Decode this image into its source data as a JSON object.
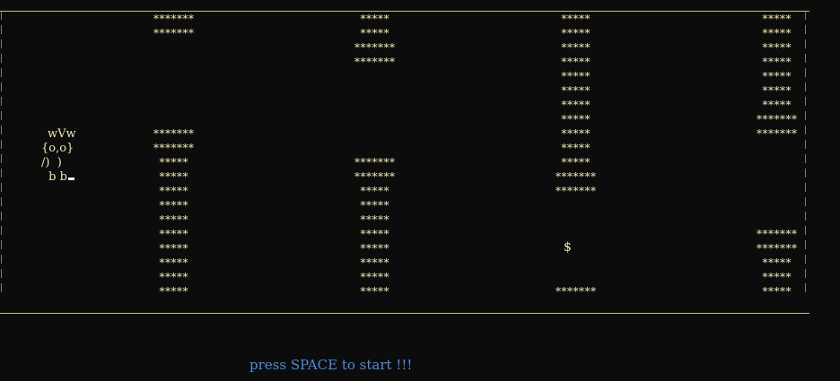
{
  "game": {
    "start_prompt": "press SPACE to start !!!",
    "player": {
      "line1": "wVw",
      "line2": "{o,o}",
      "line3": "/)  )",
      "line4": " b b"
    },
    "coin": "$",
    "wall_wide": "*******",
    "wall_narrow": "*****"
  },
  "colors": {
    "background": "#0c0c0c",
    "walls": "#f2e9b6",
    "border": "#cdbd85",
    "prompt": "#4c8cdc",
    "cursor": "#ffffff"
  },
  "walls": [
    {
      "column": 1,
      "rows": [
        {
          "row": 0,
          "text": "*******"
        },
        {
          "row": 1,
          "text": "*******"
        },
        {
          "row": 8,
          "text": "*******"
        },
        {
          "row": 9,
          "text": "*******"
        },
        {
          "row": 10,
          "text": "*****"
        },
        {
          "row": 11,
          "text": "*****"
        },
        {
          "row": 12,
          "text": "*****"
        },
        {
          "row": 13,
          "text": "*****"
        },
        {
          "row": 14,
          "text": "*****"
        },
        {
          "row": 15,
          "text": "*****"
        },
        {
          "row": 16,
          "text": "*****"
        },
        {
          "row": 17,
          "text": "*****"
        },
        {
          "row": 18,
          "text": "*****"
        },
        {
          "row": 19,
          "text": "*****"
        }
      ]
    },
    {
      "column": 2,
      "rows": [
        {
          "row": 0,
          "text": "*****"
        },
        {
          "row": 1,
          "text": "*****"
        },
        {
          "row": 2,
          "text": "*******"
        },
        {
          "row": 3,
          "text": "*******"
        },
        {
          "row": 10,
          "text": "*******"
        },
        {
          "row": 11,
          "text": "*******"
        },
        {
          "row": 12,
          "text": "*****"
        },
        {
          "row": 13,
          "text": "*****"
        },
        {
          "row": 14,
          "text": "*****"
        },
        {
          "row": 15,
          "text": "*****"
        },
        {
          "row": 16,
          "text": "*****"
        },
        {
          "row": 17,
          "text": "*****"
        },
        {
          "row": 18,
          "text": "*****"
        },
        {
          "row": 19,
          "text": "*****"
        }
      ]
    },
    {
      "column": 3,
      "rows": [
        {
          "row": 0,
          "text": "*****"
        },
        {
          "row": 1,
          "text": "*****"
        },
        {
          "row": 2,
          "text": "*****"
        },
        {
          "row": 3,
          "text": "*****"
        },
        {
          "row": 4,
          "text": "*****"
        },
        {
          "row": 5,
          "text": "*****"
        },
        {
          "row": 6,
          "text": "*****"
        },
        {
          "row": 7,
          "text": "*****"
        },
        {
          "row": 8,
          "text": "*****"
        },
        {
          "row": 9,
          "text": "*****"
        },
        {
          "row": 10,
          "text": "*****"
        },
        {
          "row": 11,
          "text": "*******"
        },
        {
          "row": 12,
          "text": "*******"
        },
        {
          "row": 19,
          "text": "*******"
        }
      ]
    },
    {
      "column": 4,
      "rows": [
        {
          "row": 0,
          "text": "*****"
        },
        {
          "row": 1,
          "text": "*****"
        },
        {
          "row": 2,
          "text": "*****"
        },
        {
          "row": 3,
          "text": "*****"
        },
        {
          "row": 4,
          "text": "*****"
        },
        {
          "row": 5,
          "text": "*****"
        },
        {
          "row": 6,
          "text": "*****"
        },
        {
          "row": 7,
          "text": "*******"
        },
        {
          "row": 8,
          "text": "*******"
        },
        {
          "row": 15,
          "text": "*******"
        },
        {
          "row": 16,
          "text": "*******"
        },
        {
          "row": 17,
          "text": "*****"
        },
        {
          "row": 18,
          "text": "*****"
        },
        {
          "row": 19,
          "text": "*****"
        }
      ]
    }
  ]
}
